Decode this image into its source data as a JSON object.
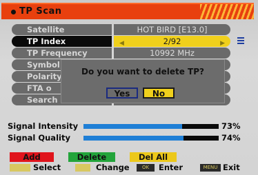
{
  "title": "TP Scan",
  "menu": [
    {
      "label": "Satellite",
      "value": "HOT BIRD [E13.0]"
    },
    {
      "label": "TP Index",
      "value": "2/92"
    },
    {
      "label": "TP Frequency",
      "value": "10992 MHz"
    },
    {
      "label": "Symbol",
      "value": ""
    },
    {
      "label": "Polarity",
      "value": ""
    },
    {
      "label": "FTA o",
      "value": ""
    },
    {
      "label": "Search",
      "value": ""
    }
  ],
  "dialog": {
    "question": "Do you want to delete TP?",
    "yes_label": "Yes",
    "no_label": "No"
  },
  "signal": {
    "intensity_label": "Signal Intensity",
    "intensity_percent": "73%",
    "intensity_value": 73,
    "quality_label": "Signal Quality",
    "quality_percent": "74%",
    "quality_value": 74
  },
  "color_buttons": {
    "red": "Add",
    "green": "Delete",
    "yellow": "Del All"
  },
  "hints": {
    "select": "Select",
    "change": "Change",
    "ok_key": "OK",
    "enter": "Enter",
    "menu_key": "MENU",
    "exit": "Exit"
  }
}
